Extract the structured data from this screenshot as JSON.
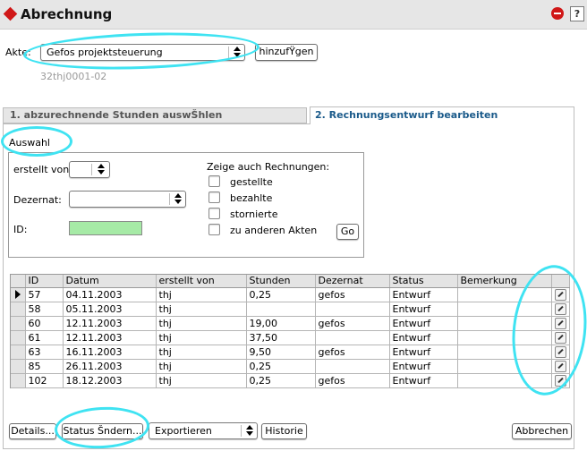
{
  "window": {
    "title": "Abrechnung",
    "help_label": "?"
  },
  "akte": {
    "label": "Akte:",
    "selected": "Gefos projektsteuerung",
    "add_button": "hinzufŸgen",
    "sub_id": "32thj0001-02"
  },
  "tabs": [
    {
      "label": "1. abzurechnende Stunden auswŠhlen"
    },
    {
      "label": "2. Rechnungsentwurf bearbeiten"
    }
  ],
  "auswahl": {
    "title": "Auswahl",
    "erstellt_von_label": "erstellt von:",
    "dezernat_label": "Dezernat:",
    "id_label": "ID:",
    "zeige_label": "Zeige auch Rechnungen:",
    "checkboxes": [
      "gestellte",
      "bezahlte",
      "stornierte",
      "zu anderen Akten"
    ],
    "go_button": "Go"
  },
  "table": {
    "columns": [
      "ID",
      "Datum",
      "erstellt von",
      "Stunden",
      "Dezernat",
      "Status",
      "Bemerkung"
    ],
    "rows": [
      [
        "57",
        "04.11.2003",
        "thj",
        "0,25",
        "gefos",
        "Entwurf",
        ""
      ],
      [
        "58",
        "05.11.2003",
        "thj",
        "",
        "",
        "Entwurf",
        ""
      ],
      [
        "60",
        "12.11.2003",
        "thj",
        "19,00",
        "gefos",
        "Entwurf",
        ""
      ],
      [
        "61",
        "12.11.2003",
        "thj",
        "37,50",
        "",
        "Entwurf",
        ""
      ],
      [
        "63",
        "16.11.2003",
        "thj",
        "9,50",
        "gefos",
        "Entwurf",
        ""
      ],
      [
        "85",
        "26.11.2003",
        "thj",
        "0,25",
        "",
        "Entwurf",
        ""
      ],
      [
        "102",
        "18.12.2003",
        "thj",
        "0,25",
        "gefos",
        "Entwurf",
        ""
      ]
    ]
  },
  "footer": {
    "details_button": "Details...",
    "status_button": "Status Šndern...",
    "export_select": "Exportieren",
    "history_button": "Historie",
    "cancel_button": "Abbrechen"
  },
  "colors": {
    "annotation": "#3fe3f2",
    "id_field": "#a6eaa6",
    "tab_active_text": "#1a5a8a"
  }
}
